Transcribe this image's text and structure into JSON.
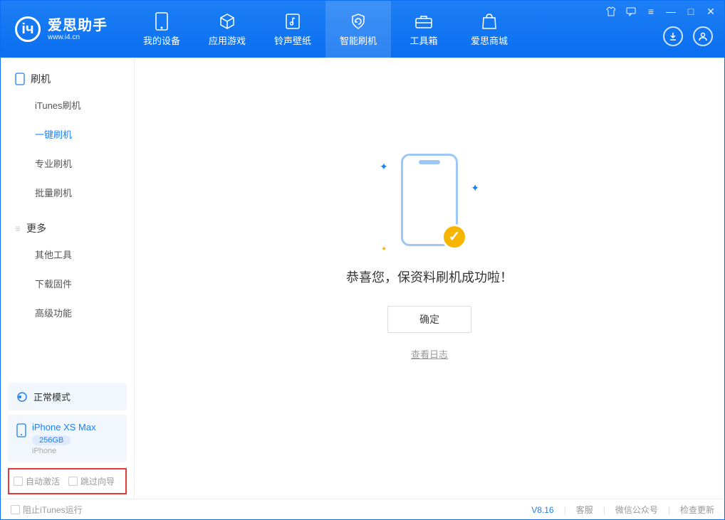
{
  "app": {
    "title": "爱思助手",
    "url": "www.i4.cn"
  },
  "tabs": {
    "device": "我的设备",
    "apps": "应用游戏",
    "rings": "铃声壁纸",
    "flash": "智能刷机",
    "tools": "工具箱",
    "store": "爱思商城"
  },
  "sidebar": {
    "section1": "刷机",
    "items1": [
      "iTunes刷机",
      "一键刷机",
      "专业刷机",
      "批量刷机"
    ],
    "section2": "更多",
    "items2": [
      "其他工具",
      "下载固件",
      "高级功能"
    ]
  },
  "device": {
    "mode": "正常模式",
    "name": "iPhone XS Max",
    "capacity": "256GB",
    "type": "iPhone"
  },
  "options": {
    "auto_activate": "自动激活",
    "skip_guide": "跳过向导"
  },
  "main": {
    "success": "恭喜您，保资料刷机成功啦！",
    "ok": "确定",
    "view_log": "查看日志"
  },
  "footer": {
    "block_itunes": "阻止iTunes运行",
    "version": "V8.16",
    "support": "客服",
    "wechat": "微信公众号",
    "update": "检查更新"
  }
}
